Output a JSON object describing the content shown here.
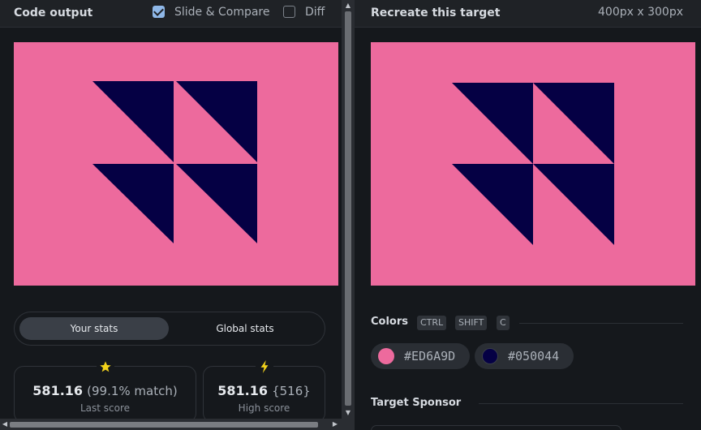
{
  "left": {
    "title": "Code output",
    "slide_compare": {
      "label": "Slide & Compare",
      "checked": true
    },
    "diff": {
      "label": "Diff",
      "checked": false
    }
  },
  "right": {
    "title": "Recreate this target",
    "dimensions": "400px x 300px"
  },
  "colors": {
    "background": "#ED6A9D",
    "shape": "#050044",
    "accent": "#8fb8e8"
  },
  "stats": {
    "tabs": [
      {
        "label": "Your stats",
        "active": true
      },
      {
        "label": "Global stats",
        "active": false
      }
    ],
    "last": {
      "icon": "star-icon",
      "value": "581.16",
      "detail": "(99.1% match)",
      "label": "Last score"
    },
    "high": {
      "icon": "lightning-icon",
      "value": "581.16",
      "detail": "{516}",
      "label": "High score"
    }
  },
  "palette": {
    "title": "Colors",
    "shortcut_keys": [
      "CTRL",
      "SHIFT",
      "C"
    ],
    "swatches": [
      {
        "hex": "#ED6A9D"
      },
      {
        "hex": "#050044"
      }
    ]
  },
  "sponsor": {
    "title": "Target Sponsor"
  }
}
